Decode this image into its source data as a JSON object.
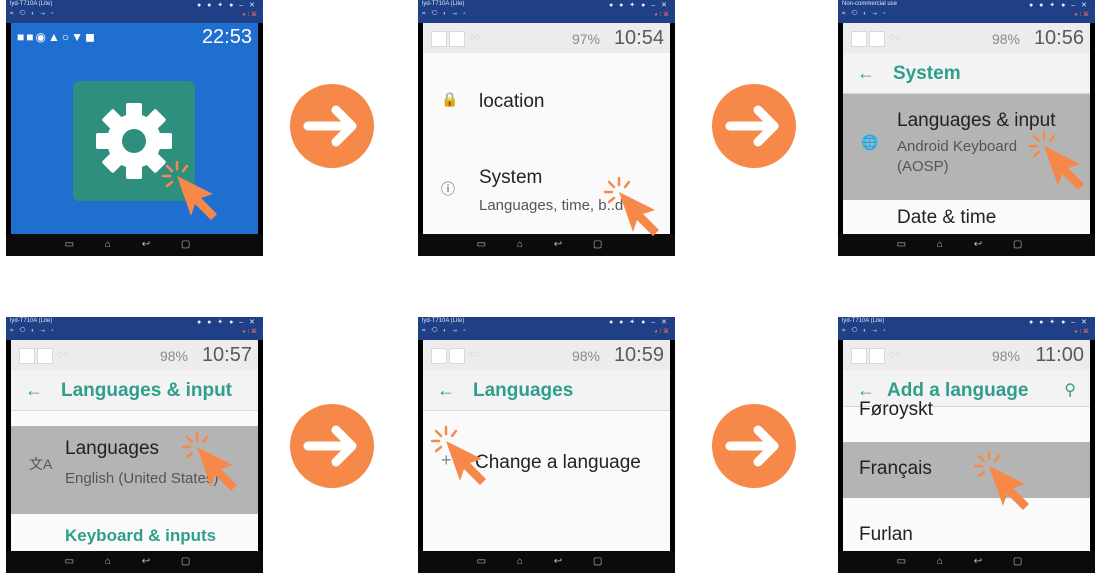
{
  "colors": {
    "accent": "#2f9e8c",
    "arrow": "#f6894a",
    "cursor": "#f6894a",
    "selected_row": "#b4b4b4",
    "window_titlebar": "#1f3f86"
  },
  "window": {
    "titles": [
      "lyd-T710A (Lite)",
      "lyd-T710A (Lite)",
      "Non-commercial use",
      "lyd-T710A (Lite)",
      "lyd-T710A (Lite)",
      "lyd-T710A (Lite)"
    ],
    "controls": "● ● ✦ ● – ✕",
    "toolbar": "⌗ ⟲ ◐ ⇥ ⌑",
    "right_icons": "◕ ⁝ ⌘"
  },
  "nav_icons": "▭ ⌂ ↩ ▢",
  "step1": {
    "time": "22:53",
    "status_icons": "■■◉▲○▼◼",
    "battery": "◧ ▮"
  },
  "step2": {
    "time": "10:54",
    "battery": "97%",
    "rows": [
      {
        "icon": "lock-icon",
        "title": "location"
      },
      {
        "icon": "info-icon",
        "title": "System",
        "subtitle": "Languages, time, b..d"
      }
    ]
  },
  "step3": {
    "time": "10:56",
    "battery": "98%",
    "appbar_title": "System",
    "rows": [
      {
        "icon": "globe-icon",
        "title": "Languages & input",
        "subtitle": "Android Keyboard",
        "subtitle2": "(AOSP)"
      },
      {
        "title": "Date & time"
      }
    ]
  },
  "step4": {
    "time": "10:57",
    "battery": "98%",
    "appbar_title": "Languages & input",
    "rows": [
      {
        "icon": "translate-icon",
        "title": "Languages",
        "subtitle": "English (United States)"
      },
      {
        "title": "Keyboard & inputs"
      }
    ]
  },
  "step5": {
    "time": "10:59",
    "battery": "98%",
    "appbar_title": "Languages",
    "rows": [
      {
        "icon": "plus-icon",
        "title": "Change a language"
      }
    ]
  },
  "step6": {
    "time": "11:00",
    "battery": "98%",
    "appbar_title": "Add a language",
    "search_icon": "search-icon",
    "rows": [
      {
        "title": "Føroyskt"
      },
      {
        "title": "Français"
      },
      {
        "title": "Furlan"
      }
    ]
  }
}
